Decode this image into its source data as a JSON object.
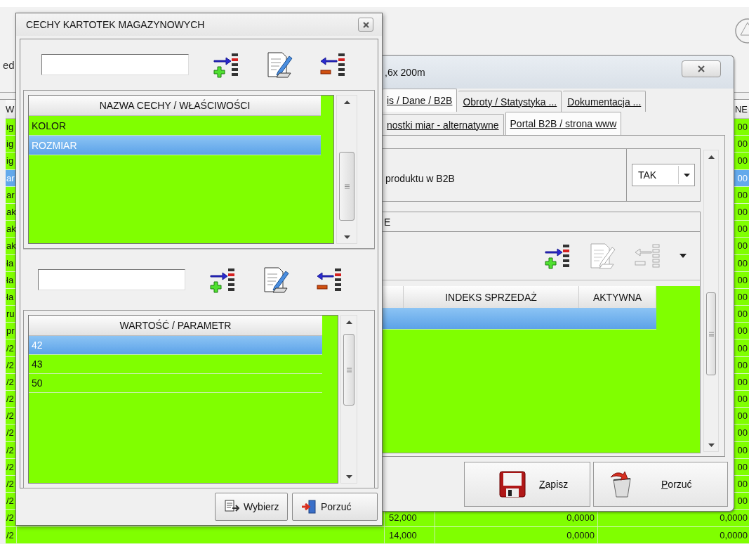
{
  "background_window": {
    "toolbar_fragment": "ed",
    "table": {
      "column_1_header": "W",
      "column_5_header": "NE",
      "rows": [
        {
          "column_1": "ig",
          "column_5": "00",
          "selected": false
        },
        {
          "column_1": "ig",
          "column_5": "00",
          "selected": false
        },
        {
          "column_1": "ig",
          "column_5": "00",
          "selected": false
        },
        {
          "column_1": "ar",
          "column_5": "00",
          "selected": true
        },
        {
          "column_1": "ar",
          "column_5": "00",
          "selected": false
        },
        {
          "column_1": "ak",
          "column_5": "00",
          "selected": false
        },
        {
          "column_1": "ak",
          "column_5": "00",
          "selected": false
        },
        {
          "column_1": "ak",
          "column_5": "00",
          "selected": false
        },
        {
          "column_1": "ła",
          "column_5": "00",
          "selected": false
        },
        {
          "column_1": "ła",
          "column_5": "00",
          "selected": false
        },
        {
          "column_1": "ła",
          "column_5": "00",
          "selected": false
        },
        {
          "column_1": "ru",
          "column_5": "00",
          "selected": false
        },
        {
          "column_1": "pr",
          "column_5": "00",
          "selected": false
        },
        {
          "column_1": "/2",
          "column_5": "00",
          "selected": false
        },
        {
          "column_1": "/2",
          "column_5": "00",
          "selected": false
        },
        {
          "column_1": "/2",
          "column_5": "00",
          "selected": false
        },
        {
          "column_1": "/2",
          "column_5": "00",
          "selected": false
        },
        {
          "column_1": "/2",
          "column_5": "00",
          "selected": false
        },
        {
          "column_1": "/2",
          "column_5": "00",
          "selected": false
        },
        {
          "column_1": "/2",
          "column_5": "00",
          "selected": false
        },
        {
          "column_1": "/2",
          "column_5": "00",
          "selected": false
        },
        {
          "column_1": "/2",
          "column_5": "00",
          "selected": false
        },
        {
          "column_1": "/2",
          "column_5": "00",
          "selected": false
        },
        {
          "column_1": "/2",
          "column_3": "52,000",
          "column_4": "0,0000",
          "column_5": "0,0000",
          "selected": false
        },
        {
          "column_1": "/2",
          "column_3": "14,000",
          "column_4": "0,0000",
          "column_5": "0,0000",
          "selected": false
        }
      ]
    }
  },
  "features_dialog": {
    "title": "CECHY KARTOTEK MAGAZYNOWYCH",
    "features_toolbar": [
      {
        "kind": "add",
        "disabled": false
      },
      {
        "kind": "edit",
        "disabled": false
      },
      {
        "kind": "remove",
        "disabled": false
      }
    ],
    "features_table": {
      "columns": [
        "NAZWA CECHY / WŁAŚCIWOŚCI"
      ],
      "rows": [
        {
          "name": "KOLOR",
          "selected": false
        },
        {
          "name": "ROZMIAR",
          "selected": true
        }
      ]
    },
    "values_toolbar": [
      {
        "kind": "add",
        "disabled": false
      },
      {
        "kind": "edit",
        "disabled": false
      },
      {
        "kind": "remove",
        "disabled": false
      }
    ],
    "values_table": {
      "columns": [
        "WARTOŚĆ / PARAMETR"
      ],
      "rows": [
        {
          "value": "42",
          "selected": true
        },
        {
          "value": "43",
          "selected": false
        },
        {
          "value": "50",
          "selected": false
        }
      ]
    },
    "buttons": [
      {
        "kind": "choose",
        "label": "Wybierz",
        "mnemonic": false
      },
      {
        "kind": "cancel",
        "label": "Porzuć",
        "mnemonic": false
      }
    ]
  },
  "product_dialog": {
    "title": ",6x 200m",
    "tab_rows": [
      [
        {
          "label": "is / Dane / B2B",
          "selected": true
        },
        {
          "label": "Obroty / Statystyka ...",
          "selected": false
        },
        {
          "label": "Dokumentacja ...",
          "selected": false
        }
      ],
      [
        {
          "label": "nostki miar - alternatywne",
          "selected": false
        },
        {
          "label": "Portal B2B / strona www",
          "selected": true
        }
      ]
    ],
    "field": {
      "label": "produktu w B2B",
      "value": "TAK"
    },
    "group": {
      "title": "E",
      "toolbar": [
        {
          "kind": "add",
          "disabled": false
        },
        {
          "kind": "edit",
          "disabled": true
        },
        {
          "kind": "remove",
          "disabled": true
        }
      ],
      "table": {
        "columns": [
          "INDEKS SPRZEDAŻ",
          "AKTYWNA"
        ],
        "rows": [
          {
            "selected": true
          }
        ]
      }
    },
    "buttons": [
      {
        "kind": "save",
        "label": "Zapisz",
        "mnemonic": true
      },
      {
        "kind": "discard",
        "label": "Porzuć",
        "mnemonic": true
      }
    ]
  }
}
